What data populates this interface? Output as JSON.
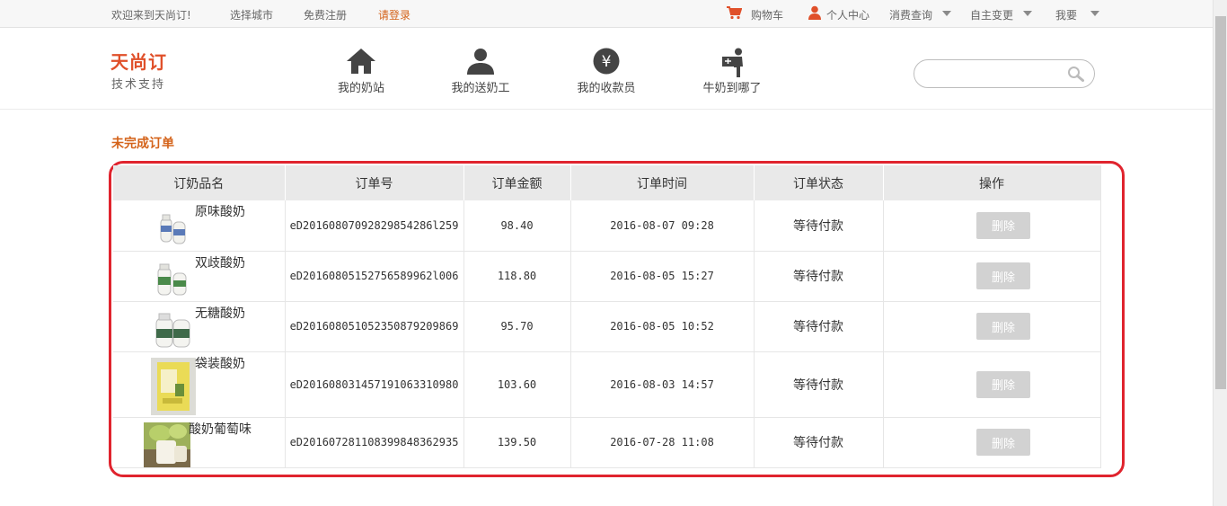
{
  "topbar": {
    "welcome": "欢迎来到天尚订!",
    "select_city": "选择城市",
    "register": "免费注册",
    "login": "请登录",
    "cart": "购物车",
    "user_center": "个人中心",
    "consume_query": "消费查询",
    "self_change": "自主变更",
    "i_want": "我要",
    "accent_color": "#d4631a"
  },
  "header": {
    "logo": "天尚订",
    "logo_sub": "技术支持",
    "nav": [
      {
        "label": "我的奶站",
        "icon": "home-icon"
      },
      {
        "label": "我的送奶工",
        "icon": "person-icon"
      },
      {
        "label": "我的收款员",
        "icon": "yen-icon"
      },
      {
        "label": "牛奶到哪了",
        "icon": "delivery-icon"
      }
    ],
    "search_placeholder": ""
  },
  "section": {
    "title": "未完成订单"
  },
  "table": {
    "headers": [
      "订奶品名",
      "订单号",
      "订单金额",
      "订单时间",
      "订单状态",
      "操作"
    ],
    "rows": [
      {
        "product": "原味酸奶",
        "order_no": "eD20160807092829854286l259",
        "amount": "98.40",
        "time": "2016-08-07 09:28",
        "status": "等待付款",
        "action": "删除"
      },
      {
        "product": "双歧酸奶",
        "order_no": "eD20160805152756589962l006",
        "amount": "118.80",
        "time": "2016-08-05 15:27",
        "status": "等待付款",
        "action": "删除"
      },
      {
        "product": "无糖酸奶",
        "order_no": "eD201608051052350879209869",
        "amount": "95.70",
        "time": "2016-08-05 10:52",
        "status": "等待付款",
        "action": "删除"
      },
      {
        "product": "袋装酸奶",
        "order_no": "eD201608031457191063310980",
        "amount": "103.60",
        "time": "2016-08-03 14:57",
        "status": "等待付款",
        "action": "删除"
      },
      {
        "product": "酸奶葡萄味",
        "order_no": "eD201607281108399848362935",
        "amount": "139.50",
        "time": "2016-07-28 11:08",
        "status": "等待付款",
        "action": "删除"
      }
    ]
  },
  "colors": {
    "highlight_frame": "#e0242e",
    "logo": "#e0502a",
    "delete_button": "#d2d2d2"
  }
}
